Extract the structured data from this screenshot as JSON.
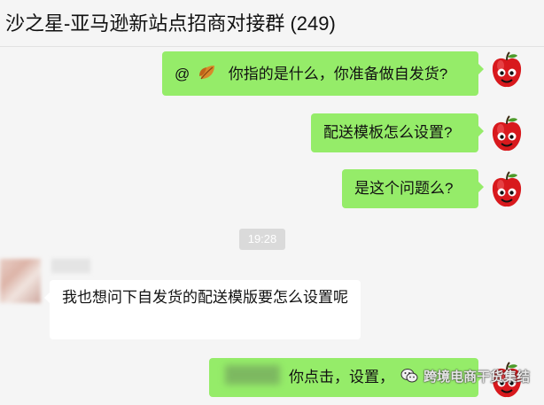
{
  "header": {
    "title": "沙之星-亚马逊新站点招商对接群 (249)"
  },
  "messages": [
    {
      "mention": "@",
      "text": "你指的是什么，你准备做自发货?"
    },
    {
      "text": "配送模板怎么设置?"
    },
    {
      "text": "是这个问题么?"
    },
    {
      "text": "我也想问下自发货的配送模版要怎么设置呢"
    },
    {
      "text": "你点击，设置，"
    }
  ],
  "time_divider": "19:28",
  "watermark": {
    "text": "跨境电商干货集结"
  },
  "colors": {
    "outgoing": "#95ec69",
    "incoming": "#ffffff",
    "background": "#f5f5f5"
  },
  "icons": [
    "leaf-emoji-icon",
    "apple-avatar-icon",
    "wechat-icon"
  ]
}
